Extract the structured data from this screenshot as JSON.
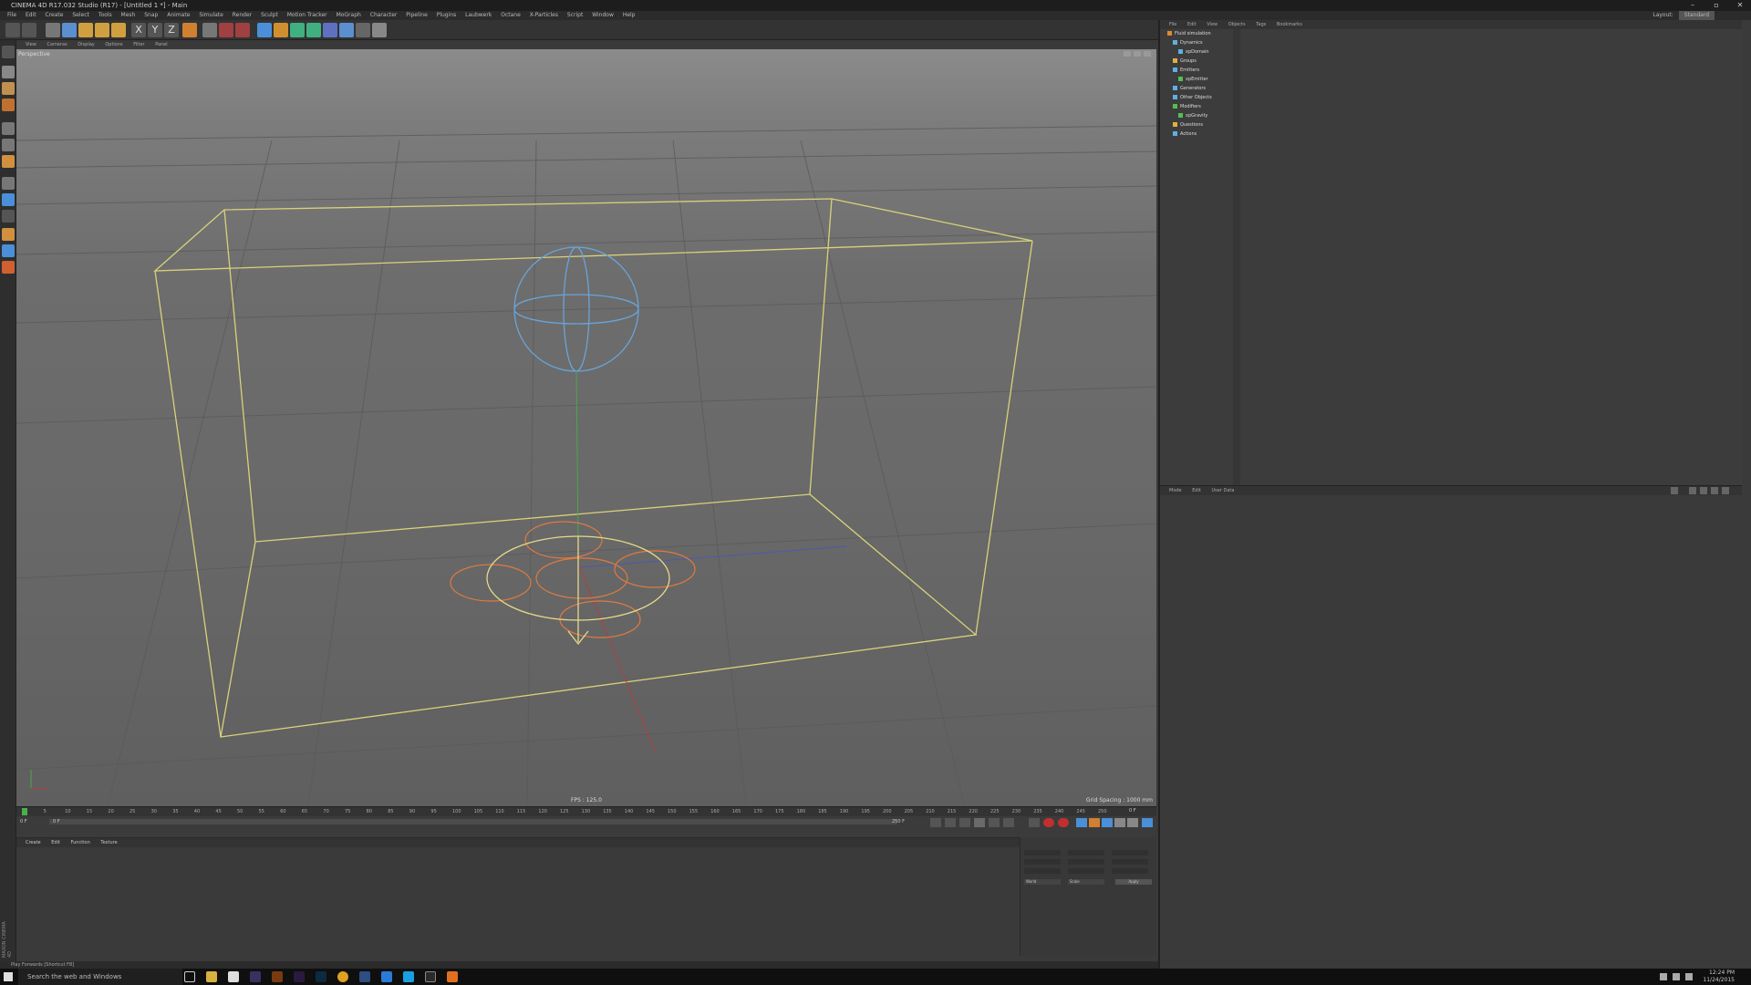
{
  "titlebar": {
    "title": "CINEMA 4D R17.032 Studio (R17) - [Untitled 1 *] - Main"
  },
  "menubar": {
    "items": [
      "File",
      "Edit",
      "Create",
      "Select",
      "Tools",
      "Mesh",
      "Snap",
      "Animate",
      "Simulate",
      "Render",
      "Sculpt",
      "Motion Tracker",
      "MoGraph",
      "Character",
      "Pipeline",
      "Plugins",
      "Laubwerk",
      "Octane",
      "X-Particles",
      "Script",
      "Window",
      "Help"
    ],
    "layout_label": "Layout:",
    "layout_value": "Standard"
  },
  "viewport": {
    "menu": [
      "View",
      "Cameras",
      "Display",
      "Options",
      "Filter",
      "Panel"
    ],
    "label": "Perspective",
    "fps": "FPS : 125.0",
    "grid_spacing": "Grid Spacing : 1000 mm"
  },
  "timeline": {
    "ticks": [
      "0",
      "5",
      "10",
      "15",
      "20",
      "25",
      "30",
      "35",
      "40",
      "45",
      "50",
      "55",
      "60",
      "65",
      "70",
      "75",
      "80",
      "85",
      "90",
      "95",
      "100",
      "105",
      "110",
      "115",
      "120",
      "125",
      "130",
      "135",
      "140",
      "145",
      "150",
      "155",
      "160",
      "165",
      "170",
      "175",
      "180",
      "185",
      "190",
      "195",
      "200",
      "205",
      "210",
      "215",
      "220",
      "225",
      "230",
      "235",
      "240",
      "245",
      "250"
    ],
    "start_frame": "0 F",
    "current_frame": "0 F",
    "end_frame": "250 F",
    "end_display": "0 F"
  },
  "material_manager": {
    "menu": [
      "Create",
      "Edit",
      "Function",
      "Texture"
    ]
  },
  "coords": {
    "apply": "Apply",
    "world": "World",
    "scale": "Scale"
  },
  "status": "Play Forwards [Shortcut F8]",
  "object_manager": {
    "menu": [
      "File",
      "Edit",
      "View",
      "Objects",
      "Tags",
      "Bookmarks"
    ],
    "objects": [
      {
        "name": "Fluid simulation",
        "indent": 0,
        "color": "#e08a2a"
      },
      {
        "name": "Dynamics",
        "indent": 1,
        "color": "#5db0e0"
      },
      {
        "name": "xpDomain",
        "indent": 2,
        "color": "#5db0e0"
      },
      {
        "name": "Groups",
        "indent": 1,
        "color": "#e0b040"
      },
      {
        "name": "Emitters",
        "indent": 1,
        "color": "#5db0e0"
      },
      {
        "name": "xpEmitter",
        "indent": 2,
        "color": "#50c050"
      },
      {
        "name": "Generators",
        "indent": 1,
        "color": "#5db0e0"
      },
      {
        "name": "Other Objects",
        "indent": 1,
        "color": "#5db0e0"
      },
      {
        "name": "Modifiers",
        "indent": 1,
        "color": "#50c050"
      },
      {
        "name": "xpGravity",
        "indent": 2,
        "color": "#50c050"
      },
      {
        "name": "Questions",
        "indent": 1,
        "color": "#e0b040"
      },
      {
        "name": "Actions",
        "indent": 1,
        "color": "#5db0e0"
      }
    ]
  },
  "attribute_manager": {
    "menu": [
      "Mode",
      "Edit",
      "User Data"
    ]
  },
  "taskbar": {
    "search_placeholder": "Search the web and Windows",
    "time": "12:24 PM",
    "date": "11/24/2015"
  },
  "brand": "MAXON CINEMA 4D"
}
